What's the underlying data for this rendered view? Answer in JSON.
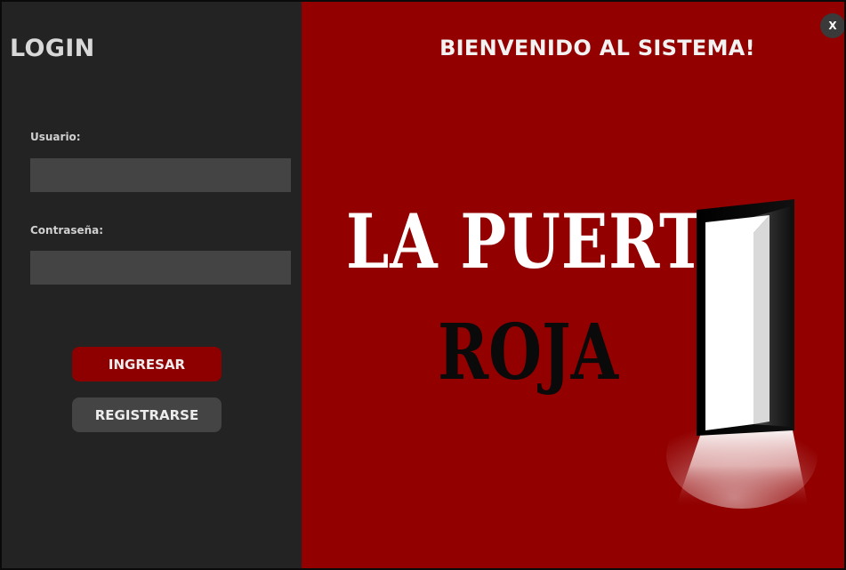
{
  "login_panel": {
    "title": "LOGIN",
    "username_label": "Usuario:",
    "username_value": "",
    "password_label": "Contraseña:",
    "password_value": "",
    "login_button": "INGRESAR",
    "register_button": "REGISTRARSE"
  },
  "brand_panel": {
    "welcome": "BIENVENIDO AL SISTEMA!",
    "logo_line1": "LA PUERTA",
    "logo_line2": "ROJA",
    "logo_icon": "open-door-icon",
    "close_label": "X"
  },
  "colors": {
    "panel_dark": "#232323",
    "input_bg": "#444444",
    "brand_red": "#920000",
    "button_red": "#8e0000"
  }
}
